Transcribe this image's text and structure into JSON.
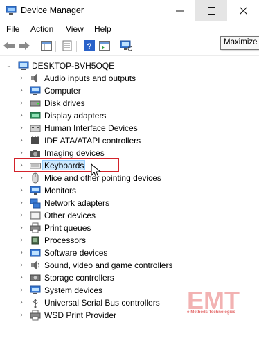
{
  "window": {
    "title": "Device Manager",
    "tooltip": "Maximize"
  },
  "menu": [
    "File",
    "Action",
    "View",
    "Help"
  ],
  "toolbar": {
    "buttons": [
      "back-icon",
      "forward-icon",
      "show-hide-console-tree-icon",
      "properties-icon",
      "help-icon",
      "action-pane-icon",
      "scan-hardware-icon"
    ]
  },
  "tree": {
    "root": "DESKTOP-BVH5OQE",
    "items": [
      {
        "label": "Audio inputs and outputs",
        "icon": "speaker-icon"
      },
      {
        "label": "Computer",
        "icon": "computer-icon"
      },
      {
        "label": "Disk drives",
        "icon": "disk-drive-icon"
      },
      {
        "label": "Display adapters",
        "icon": "display-adapter-icon"
      },
      {
        "label": "Human Interface Devices",
        "icon": "hid-icon"
      },
      {
        "label": "IDE ATA/ATAPI controllers",
        "icon": "ide-controller-icon"
      },
      {
        "label": "Imaging devices",
        "icon": "camera-icon"
      },
      {
        "label": "Keyboards",
        "icon": "keyboard-icon"
      },
      {
        "label": "Mice and other pointing devices",
        "icon": "mouse-icon"
      },
      {
        "label": "Monitors",
        "icon": "monitor-icon"
      },
      {
        "label": "Network adapters",
        "icon": "network-adapter-icon"
      },
      {
        "label": "Other devices",
        "icon": "other-devices-icon"
      },
      {
        "label": "Print queues",
        "icon": "printer-icon"
      },
      {
        "label": "Processors",
        "icon": "processor-icon"
      },
      {
        "label": "Software devices",
        "icon": "software-device-icon"
      },
      {
        "label": "Sound, video and game controllers",
        "icon": "sound-icon"
      },
      {
        "label": "Storage controllers",
        "icon": "storage-controller-icon"
      },
      {
        "label": "System devices",
        "icon": "system-devices-icon"
      },
      {
        "label": "Universal Serial Bus controllers",
        "icon": "usb-icon"
      },
      {
        "label": "WSD Print Provider",
        "icon": "wsd-printer-icon"
      }
    ]
  },
  "annotation": {
    "highlight_color": "#d3222a",
    "highlighted_item": "Keyboards"
  },
  "watermark": {
    "text": "e-Methods Technologies",
    "logo": "EMT",
    "color": "#e36a6a"
  }
}
